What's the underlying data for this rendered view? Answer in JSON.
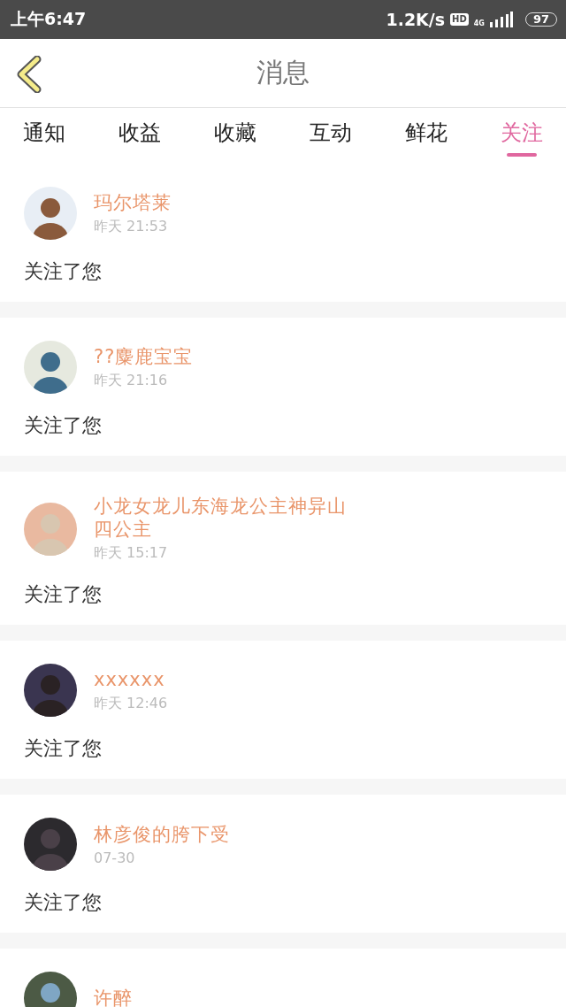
{
  "status_bar": {
    "time": "上午6:47",
    "speed": "1.2K/s",
    "hd": "HD",
    "network": "4G",
    "battery": "97"
  },
  "header": {
    "title": "消息"
  },
  "tabs": [
    {
      "label": "通知",
      "selected": false
    },
    {
      "label": "收益",
      "selected": false
    },
    {
      "label": "收藏",
      "selected": false
    },
    {
      "label": "互动",
      "selected": false
    },
    {
      "label": "鲜花",
      "selected": false
    },
    {
      "label": "关注",
      "selected": true
    }
  ],
  "messages": [
    {
      "name": "玛尔塔莱",
      "time": "昨天 21:53",
      "text": "关注了您"
    },
    {
      "name": "??麋鹿宝宝",
      "time": "昨天 21:16",
      "text": "关注了您"
    },
    {
      "name": "小龙女龙儿东海龙公主神异山四公主",
      "time": "昨天 15:17",
      "text": "关注了您"
    },
    {
      "name": "xxxxxx",
      "time": "昨天 12:46",
      "text": "关注了您"
    },
    {
      "name": "林彦俊的胯下受",
      "time": "07-30",
      "text": "关注了您"
    },
    {
      "name": "许醉"
    }
  ]
}
